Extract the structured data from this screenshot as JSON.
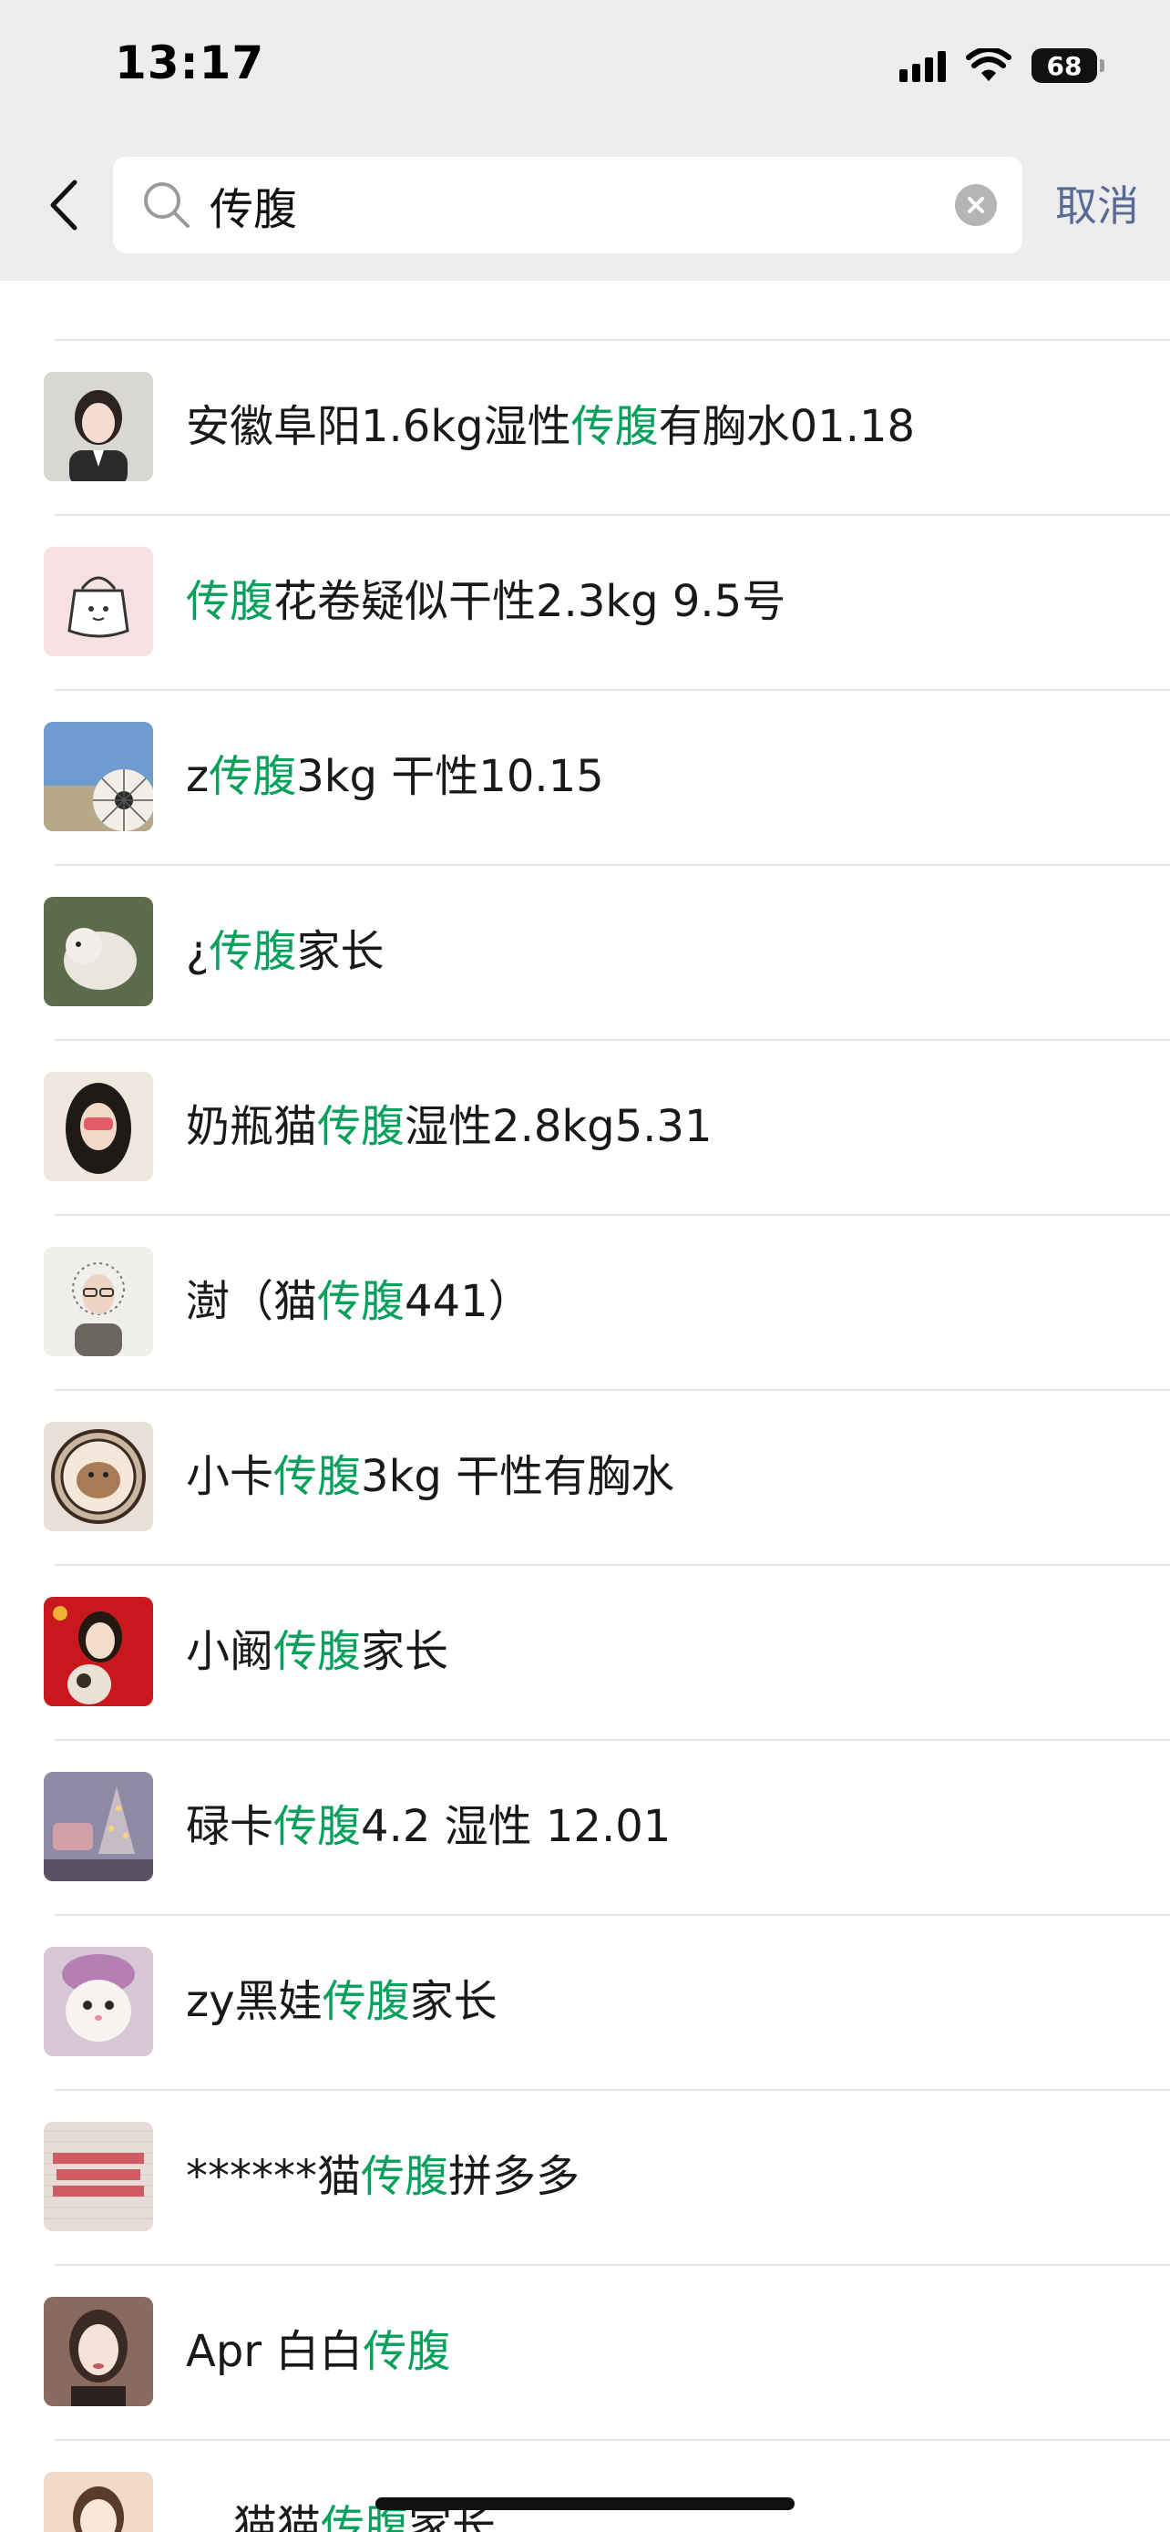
{
  "status_bar": {
    "time": "13:17",
    "battery": "68"
  },
  "search": {
    "query": "传腹",
    "cancel_label": "取消"
  },
  "results": [
    {
      "before": "安徽阜阳1.6kg湿性",
      "match": "传腹",
      "after": "有胸水01.18"
    },
    {
      "before": "",
      "match": "传腹",
      "after": "花卷疑似干性2.3kg  9.5号"
    },
    {
      "before": "z",
      "match": "传腹",
      "after": "3kg 干性10.15"
    },
    {
      "before": "¿",
      "match": "传腹",
      "after": "家长"
    },
    {
      "before": "奶瓶猫",
      "match": "传腹",
      "after": "湿性2.8kg5.31"
    },
    {
      "before": "澍（猫",
      "match": "传腹",
      "after": "441）"
    },
    {
      "before": "小卡",
      "match": "传腹",
      "after": "3kg 干性有胸水"
    },
    {
      "before": "小阚",
      "match": "传腹",
      "after": "家长"
    },
    {
      "before": "碌卡",
      "match": "传腹",
      "after": "4.2 湿性 12.01"
    },
    {
      "before": "zy黑娃",
      "match": "传腹",
      "after": "家长"
    },
    {
      "before": "******猫",
      "match": "传腹",
      "after": "拼多多"
    },
    {
      "before": "Apr 白白",
      "match": "传腹",
      "after": ""
    },
    {
      "before": "猫猫",
      "match": "传腹",
      "after": "家长"
    }
  ],
  "colors": {
    "highlight": "#07a15c",
    "cancel": "#576b95",
    "header_bg": "#ededed"
  }
}
